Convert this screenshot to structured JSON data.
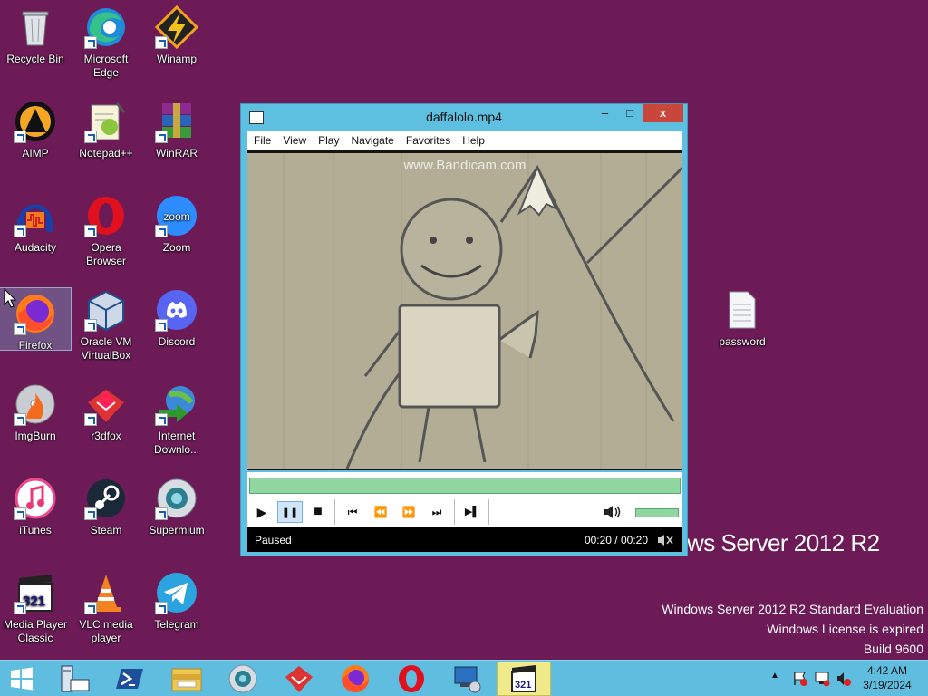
{
  "desktop": {
    "icons": [
      {
        "label": "Recycle Bin",
        "icon": "recycle-bin-icon"
      },
      {
        "label": "Microsoft Edge",
        "icon": "edge-icon"
      },
      {
        "label": "Winamp",
        "icon": "winamp-icon"
      },
      {
        "label": "AIMP",
        "icon": "aimp-icon"
      },
      {
        "label": "Notepad++",
        "icon": "notepadpp-icon"
      },
      {
        "label": "WinRAR",
        "icon": "winrar-icon"
      },
      {
        "label": "Audacity",
        "icon": "audacity-icon"
      },
      {
        "label": "Opera Browser",
        "icon": "opera-icon"
      },
      {
        "label": "Zoom",
        "icon": "zoom-icon"
      },
      {
        "label": "Firefox",
        "icon": "firefox-icon"
      },
      {
        "label": "Oracle VM VirtualBox",
        "icon": "virtualbox-icon"
      },
      {
        "label": "Discord",
        "icon": "discord-icon"
      },
      {
        "label": "ImgBurn",
        "icon": "imgburn-icon"
      },
      {
        "label": "r3dfox",
        "icon": "r3dfox-icon"
      },
      {
        "label": "Internet Downlo...",
        "icon": "idm-icon"
      },
      {
        "label": "iTunes",
        "icon": "itunes-icon"
      },
      {
        "label": "Steam",
        "icon": "steam-icon"
      },
      {
        "label": "Supermium",
        "icon": "supermium-icon"
      },
      {
        "label": "Media Player Classic",
        "icon": "mpc-icon"
      },
      {
        "label": "VLC media player",
        "icon": "vlc-icon"
      },
      {
        "label": "Telegram",
        "icon": "telegram-icon"
      },
      {
        "label": "password",
        "icon": "text-file-icon"
      }
    ],
    "server_logo": "ws Server 2012 R2",
    "watermark": {
      "line1": "Windows Server 2012 R2 Standard Evaluation",
      "line2": "Windows License is expired",
      "line3": "Build 9600"
    }
  },
  "player": {
    "title": "daffalolo.mp4",
    "window_buttons": {
      "minimize": "–",
      "maximize": "□",
      "close": "x"
    },
    "menu": [
      "File",
      "View",
      "Play",
      "Navigate",
      "Favorites",
      "Help"
    ],
    "video_watermark": "www.Bandicam.com",
    "status": "Paused",
    "time": "00:20 / 00:20",
    "progress": 1.0,
    "volume": 1.0,
    "controls": {
      "play": "▶",
      "pause": "❚❚",
      "stop": "■",
      "prev": "⏮",
      "rewind": "⏪",
      "forward": "⏩",
      "next": "⏭",
      "frame_step": "▶▌",
      "volume": "🔊"
    }
  },
  "taskbar": {
    "items": [
      "start-icon",
      "server-manager-icon",
      "powershell-icon",
      "file-explorer-icon",
      "supermium-icon",
      "r3dfox-icon",
      "firefox-icon",
      "opera-icon",
      "network-icon",
      "mpc-icon"
    ],
    "active": "mpc-icon",
    "clock_time": "4:42 AM",
    "clock_date": "3/19/2024",
    "tray_chevron": "▲"
  },
  "colors": {
    "desktop": "#6c1b57",
    "taskbar": "#5fbde0",
    "window_frame": "#5ec0e0",
    "seek_fill": "#8fd6a0"
  }
}
